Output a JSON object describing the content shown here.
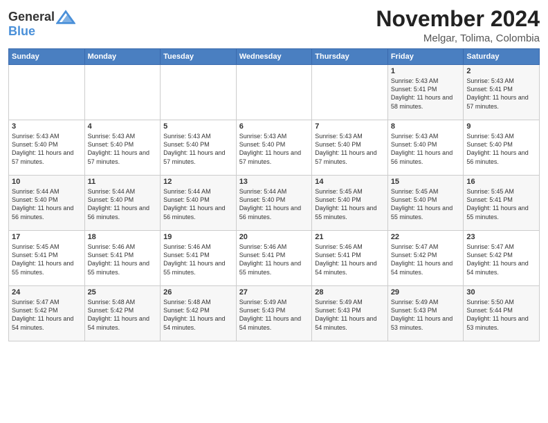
{
  "logo": {
    "line1": "General",
    "line2": "Blue"
  },
  "title": "November 2024",
  "subtitle": "Melgar, Tolima, Colombia",
  "headers": [
    "Sunday",
    "Monday",
    "Tuesday",
    "Wednesday",
    "Thursday",
    "Friday",
    "Saturday"
  ],
  "weeks": [
    [
      {
        "day": "",
        "info": ""
      },
      {
        "day": "",
        "info": ""
      },
      {
        "day": "",
        "info": ""
      },
      {
        "day": "",
        "info": ""
      },
      {
        "day": "",
        "info": ""
      },
      {
        "day": "1",
        "info": "Sunrise: 5:43 AM\nSunset: 5:41 PM\nDaylight: 11 hours and 58 minutes."
      },
      {
        "day": "2",
        "info": "Sunrise: 5:43 AM\nSunset: 5:41 PM\nDaylight: 11 hours and 57 minutes."
      }
    ],
    [
      {
        "day": "3",
        "info": "Sunrise: 5:43 AM\nSunset: 5:40 PM\nDaylight: 11 hours and 57 minutes."
      },
      {
        "day": "4",
        "info": "Sunrise: 5:43 AM\nSunset: 5:40 PM\nDaylight: 11 hours and 57 minutes."
      },
      {
        "day": "5",
        "info": "Sunrise: 5:43 AM\nSunset: 5:40 PM\nDaylight: 11 hours and 57 minutes."
      },
      {
        "day": "6",
        "info": "Sunrise: 5:43 AM\nSunset: 5:40 PM\nDaylight: 11 hours and 57 minutes."
      },
      {
        "day": "7",
        "info": "Sunrise: 5:43 AM\nSunset: 5:40 PM\nDaylight: 11 hours and 57 minutes."
      },
      {
        "day": "8",
        "info": "Sunrise: 5:43 AM\nSunset: 5:40 PM\nDaylight: 11 hours and 56 minutes."
      },
      {
        "day": "9",
        "info": "Sunrise: 5:43 AM\nSunset: 5:40 PM\nDaylight: 11 hours and 56 minutes."
      }
    ],
    [
      {
        "day": "10",
        "info": "Sunrise: 5:44 AM\nSunset: 5:40 PM\nDaylight: 11 hours and 56 minutes."
      },
      {
        "day": "11",
        "info": "Sunrise: 5:44 AM\nSunset: 5:40 PM\nDaylight: 11 hours and 56 minutes."
      },
      {
        "day": "12",
        "info": "Sunrise: 5:44 AM\nSunset: 5:40 PM\nDaylight: 11 hours and 56 minutes."
      },
      {
        "day": "13",
        "info": "Sunrise: 5:44 AM\nSunset: 5:40 PM\nDaylight: 11 hours and 56 minutes."
      },
      {
        "day": "14",
        "info": "Sunrise: 5:45 AM\nSunset: 5:40 PM\nDaylight: 11 hours and 55 minutes."
      },
      {
        "day": "15",
        "info": "Sunrise: 5:45 AM\nSunset: 5:40 PM\nDaylight: 11 hours and 55 minutes."
      },
      {
        "day": "16",
        "info": "Sunrise: 5:45 AM\nSunset: 5:41 PM\nDaylight: 11 hours and 55 minutes."
      }
    ],
    [
      {
        "day": "17",
        "info": "Sunrise: 5:45 AM\nSunset: 5:41 PM\nDaylight: 11 hours and 55 minutes."
      },
      {
        "day": "18",
        "info": "Sunrise: 5:46 AM\nSunset: 5:41 PM\nDaylight: 11 hours and 55 minutes."
      },
      {
        "day": "19",
        "info": "Sunrise: 5:46 AM\nSunset: 5:41 PM\nDaylight: 11 hours and 55 minutes."
      },
      {
        "day": "20",
        "info": "Sunrise: 5:46 AM\nSunset: 5:41 PM\nDaylight: 11 hours and 55 minutes."
      },
      {
        "day": "21",
        "info": "Sunrise: 5:46 AM\nSunset: 5:41 PM\nDaylight: 11 hours and 54 minutes."
      },
      {
        "day": "22",
        "info": "Sunrise: 5:47 AM\nSunset: 5:42 PM\nDaylight: 11 hours and 54 minutes."
      },
      {
        "day": "23",
        "info": "Sunrise: 5:47 AM\nSunset: 5:42 PM\nDaylight: 11 hours and 54 minutes."
      }
    ],
    [
      {
        "day": "24",
        "info": "Sunrise: 5:47 AM\nSunset: 5:42 PM\nDaylight: 11 hours and 54 minutes."
      },
      {
        "day": "25",
        "info": "Sunrise: 5:48 AM\nSunset: 5:42 PM\nDaylight: 11 hours and 54 minutes."
      },
      {
        "day": "26",
        "info": "Sunrise: 5:48 AM\nSunset: 5:42 PM\nDaylight: 11 hours and 54 minutes."
      },
      {
        "day": "27",
        "info": "Sunrise: 5:49 AM\nSunset: 5:43 PM\nDaylight: 11 hours and 54 minutes."
      },
      {
        "day": "28",
        "info": "Sunrise: 5:49 AM\nSunset: 5:43 PM\nDaylight: 11 hours and 54 minutes."
      },
      {
        "day": "29",
        "info": "Sunrise: 5:49 AM\nSunset: 5:43 PM\nDaylight: 11 hours and 53 minutes."
      },
      {
        "day": "30",
        "info": "Sunrise: 5:50 AM\nSunset: 5:44 PM\nDaylight: 11 hours and 53 minutes."
      }
    ]
  ]
}
